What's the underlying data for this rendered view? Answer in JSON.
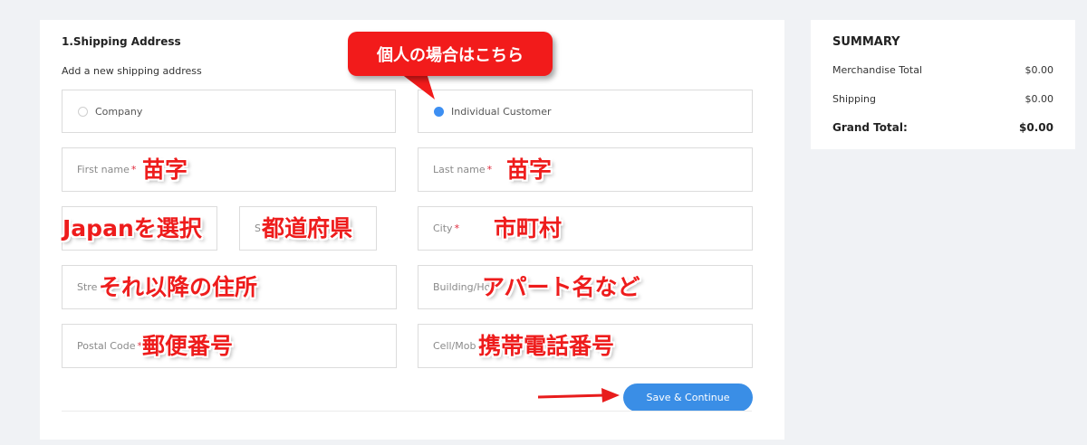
{
  "shipping": {
    "section_title": "1.Shipping Address",
    "subtitle": "Add a new shipping address",
    "customer_type": {
      "options": [
        "Company",
        "Individual Customer"
      ],
      "selected": "Individual Customer"
    },
    "fields": {
      "first_name": "First name",
      "last_name": "Last name",
      "country": "Japan",
      "state": "St",
      "city": "City",
      "street": "Stre",
      "street_tail": "ss",
      "building": "Building/Ho",
      "postal_code": "Postal Code",
      "phone": "Cell/Mob"
    },
    "required_mark": "*",
    "save_label": "Save & Continue"
  },
  "annotations": {
    "callout": "個人の場合はこちら",
    "first_name": "苗字",
    "last_name": "苗字",
    "country": "Japanを選択",
    "state": "都道府県",
    "city": "市町村",
    "street": "それ以降の住所",
    "building": "アパート名など",
    "postal_code": "郵便番号",
    "phone": "携帯電話番号",
    "color": "#ee1c1c"
  },
  "summary": {
    "title": "SUMMARY",
    "rows": [
      {
        "label": "Merchandise Total",
        "value": "$0.00"
      },
      {
        "label": "Shipping",
        "value": "$0.00"
      }
    ],
    "total": {
      "label": "Grand Total:",
      "value": "$0.00"
    }
  },
  "colors": {
    "accent": "#3a8ee6",
    "required": "#e0283a",
    "annotation_red": "#ee1c1c",
    "page_background": "#f0f2f5"
  }
}
